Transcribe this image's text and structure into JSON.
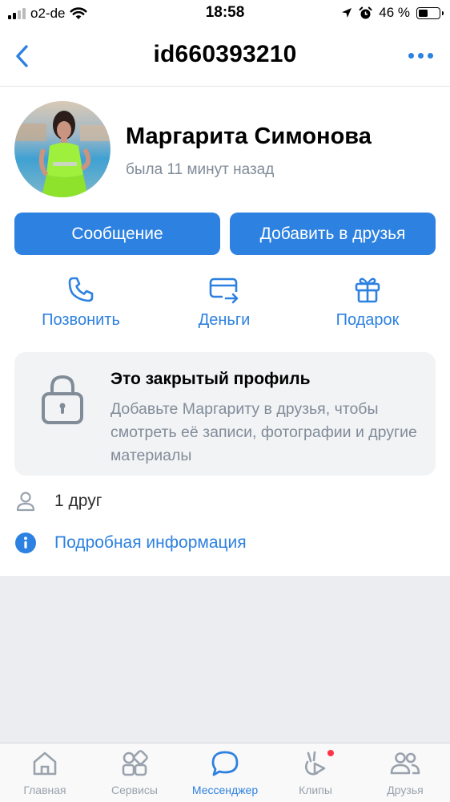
{
  "status_bar": {
    "carrier": "o2-de",
    "time": "18:58",
    "battery_percent": "46 %",
    "battery_level": 0.46,
    "icons": [
      "signal-icon",
      "wifi-icon",
      "location-icon",
      "alarm-icon",
      "battery-icon"
    ]
  },
  "nav": {
    "title": "id660393210",
    "back_icon": "chevron-left-icon",
    "more_icon": "more-horizontal-icon"
  },
  "profile": {
    "name": "Маргарита Симонова",
    "status": "была 11 минут назад"
  },
  "buttons": {
    "message": "Сообщение",
    "add_friend": "Добавить в друзья"
  },
  "actions": [
    {
      "label": "Позвонить",
      "icon": "phone-icon"
    },
    {
      "label": "Деньги",
      "icon": "money-transfer-icon"
    },
    {
      "label": "Подарок",
      "icon": "gift-icon"
    }
  ],
  "closed_profile": {
    "title": "Это закрытый профиль",
    "text": "Добавьте Маргариту в друзья, чтобы смотреть её записи, фотографии и другие материалы",
    "icon": "lock-icon"
  },
  "info": {
    "friends": "1 друг",
    "details": "Подробная информация"
  },
  "tabs": [
    {
      "label": "Главная",
      "icon": "home-icon",
      "active": false
    },
    {
      "label": "Сервисы",
      "icon": "services-icon",
      "active": false
    },
    {
      "label": "Мессенджер",
      "icon": "messenger-icon",
      "active": true
    },
    {
      "label": "Клипы",
      "icon": "clips-icon",
      "active": false,
      "badge": true
    },
    {
      "label": "Друзья",
      "icon": "friends-icon",
      "active": false
    }
  ],
  "colors": {
    "accent": "#2d81e0",
    "secondary_text": "#818c99",
    "card_bg": "#f2f3f5",
    "badge": "#ff3347"
  }
}
